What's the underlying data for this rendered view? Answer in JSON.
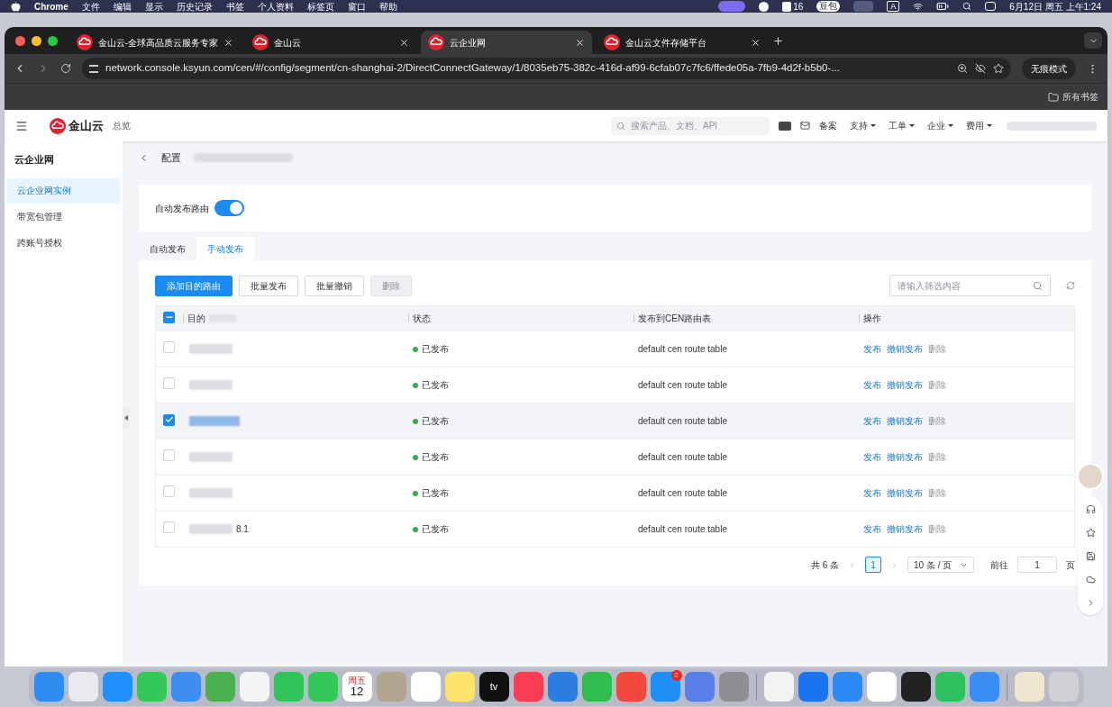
{
  "menubar": {
    "app": "Chrome",
    "menus": [
      "文件",
      "编辑",
      "显示",
      "历史记录",
      "书签",
      "个人资料",
      "标签页",
      "窗口",
      "帮助"
    ],
    "badge_count": "16",
    "doubao": "豆包",
    "input_source": "A",
    "datetime": "6月12日 周五 上午1:24"
  },
  "browser": {
    "tabs": [
      {
        "title": "金山云-全球高品质云服务专家",
        "selected": false
      },
      {
        "title": "金山云",
        "selected": false
      },
      {
        "title": "云企业网",
        "selected": true
      },
      {
        "title": "金山云文件存储平台",
        "selected": false
      }
    ],
    "url": "network.console.ksyun.com/cen/#/config/segment/cn-shanghai-2/DirectConnectGateway/1/8035eb75-382c-416d-af99-6cfab07c7fc6/ffede05a-7fb9-4d2f-b5b0-...",
    "incognito": "无痕模式",
    "bookmarks": "所有书签"
  },
  "header": {
    "logo": "金山云",
    "overview": "总览",
    "search_placeholder": "搜索产品、文档、API",
    "record": "备案",
    "menus": [
      "支持",
      "工单",
      "企业",
      "费用"
    ]
  },
  "sidebar": {
    "title": "云企业网",
    "items": [
      {
        "label": "云企业网实例",
        "selected": true
      },
      {
        "label": "带宽包管理",
        "selected": false
      },
      {
        "label": "跨账号授权",
        "selected": false
      }
    ]
  },
  "page": {
    "title": "配置",
    "auto_publish": {
      "label": "自动发布路由",
      "on": true
    },
    "tabs": [
      {
        "label": "自动发布",
        "selected": false
      },
      {
        "label": "手动发布",
        "selected": true
      }
    ],
    "buttons": [
      {
        "label": "添加目的路由",
        "kind": "primary"
      },
      {
        "label": "批量发布",
        "kind": "default"
      },
      {
        "label": "批量撤销",
        "kind": "default"
      },
      {
        "label": "删除",
        "kind": "disabled"
      }
    ],
    "filter_placeholder": "请输入筛选内容",
    "table": {
      "header_partial": true,
      "columns": [
        "目的",
        "状态",
        "发布到CEN路由表",
        "操作"
      ],
      "rows": [
        {
          "checked": false,
          "status": "已发布",
          "color": "#3ca945",
          "route_table": "default cen route table",
          "actions": [
            {
              "label": "发布",
              "disabled": false
            },
            {
              "label": "撤销发布",
              "disabled": false
            },
            {
              "label": "删除",
              "disabled": true
            }
          ]
        },
        {
          "checked": false,
          "status": "已发布",
          "color": "#3ca945",
          "route_table": "default cen route table",
          "actions": [
            {
              "label": "发布",
              "disabled": false
            },
            {
              "label": "撤销发布",
              "disabled": false
            },
            {
              "label": "删除",
              "disabled": true
            }
          ]
        },
        {
          "checked": true,
          "status": "已发布",
          "color": "#3ca945",
          "route_table": "default cen route table",
          "actions": [
            {
              "label": "发布",
              "disabled": false
            },
            {
              "label": "撤销发布",
              "disabled": false
            },
            {
              "label": "删除",
              "disabled": true
            }
          ]
        },
        {
          "checked": false,
          "status": "已发布",
          "color": "#3ca945",
          "route_table": "default cen route table",
          "actions": [
            {
              "label": "发布",
              "disabled": false
            },
            {
              "label": "撤销发布",
              "disabled": false
            },
            {
              "label": "删除",
              "disabled": true
            }
          ]
        },
        {
          "checked": false,
          "status": "已发布",
          "color": "#3ca945",
          "route_table": "default cen route table",
          "actions": [
            {
              "label": "发布",
              "disabled": false
            },
            {
              "label": "撤销发布",
              "disabled": false
            },
            {
              "label": "删除",
              "disabled": true
            }
          ]
        },
        {
          "checked": false,
          "status": "已发布",
          "color": "#3ca945",
          "route_table": "default cen route table",
          "destination_fragment": "8.1",
          "actions": [
            {
              "label": "发布",
              "disabled": false
            },
            {
              "label": "撤销发布",
              "disabled": false
            },
            {
              "label": "删除",
              "disabled": true
            }
          ]
        }
      ]
    },
    "pagination": {
      "total": "共 6 条",
      "pages": [
        {
          "label": "1",
          "selected": true
        }
      ],
      "page_size": "10 条 / 页",
      "goto_label": "前往",
      "goto_value": "1",
      "suffix": "页"
    }
  },
  "dock": [
    {
      "color": "#2f8cf0"
    },
    {
      "color": "#e9e9ef"
    },
    {
      "color": "#1e90ff"
    },
    {
      "color": "#34c759"
    },
    {
      "color": "#3d8ef0"
    },
    {
      "color": "#4caf50"
    },
    {
      "color": "#f5f5f5"
    },
    {
      "color": "#30c45a"
    },
    {
      "color": "#34c759"
    },
    {
      "color": "#ffffff",
      "top": "周五",
      "main": "12"
    },
    {
      "color": "#b0a58f"
    },
    {
      "color": "#ffffff"
    },
    {
      "color": "#fce36b"
    },
    {
      "color": "#111111",
      "main": "tv"
    },
    {
      "color": "#fa3c55"
    },
    {
      "color": "#2d7de0"
    },
    {
      "color": "#2fbd4f"
    },
    {
      "color": "#f2483d"
    },
    {
      "color": "#1f8ef5",
      "badge": "2"
    },
    {
      "color": "#5a7ee8"
    },
    {
      "color": "#8e8e93"
    },
    {
      "color": "#f3f3f3",
      "separator_before": true
    },
    {
      "color": "#1a73f0"
    },
    {
      "color": "#2b8af6"
    },
    {
      "color": "#ffffff"
    },
    {
      "color": "#222222"
    },
    {
      "color": "#2dc160"
    },
    {
      "color": "#3a8df5"
    },
    {
      "color": "#efe6d0",
      "separator_before": true
    },
    {
      "color": "#d0d0d5"
    }
  ]
}
